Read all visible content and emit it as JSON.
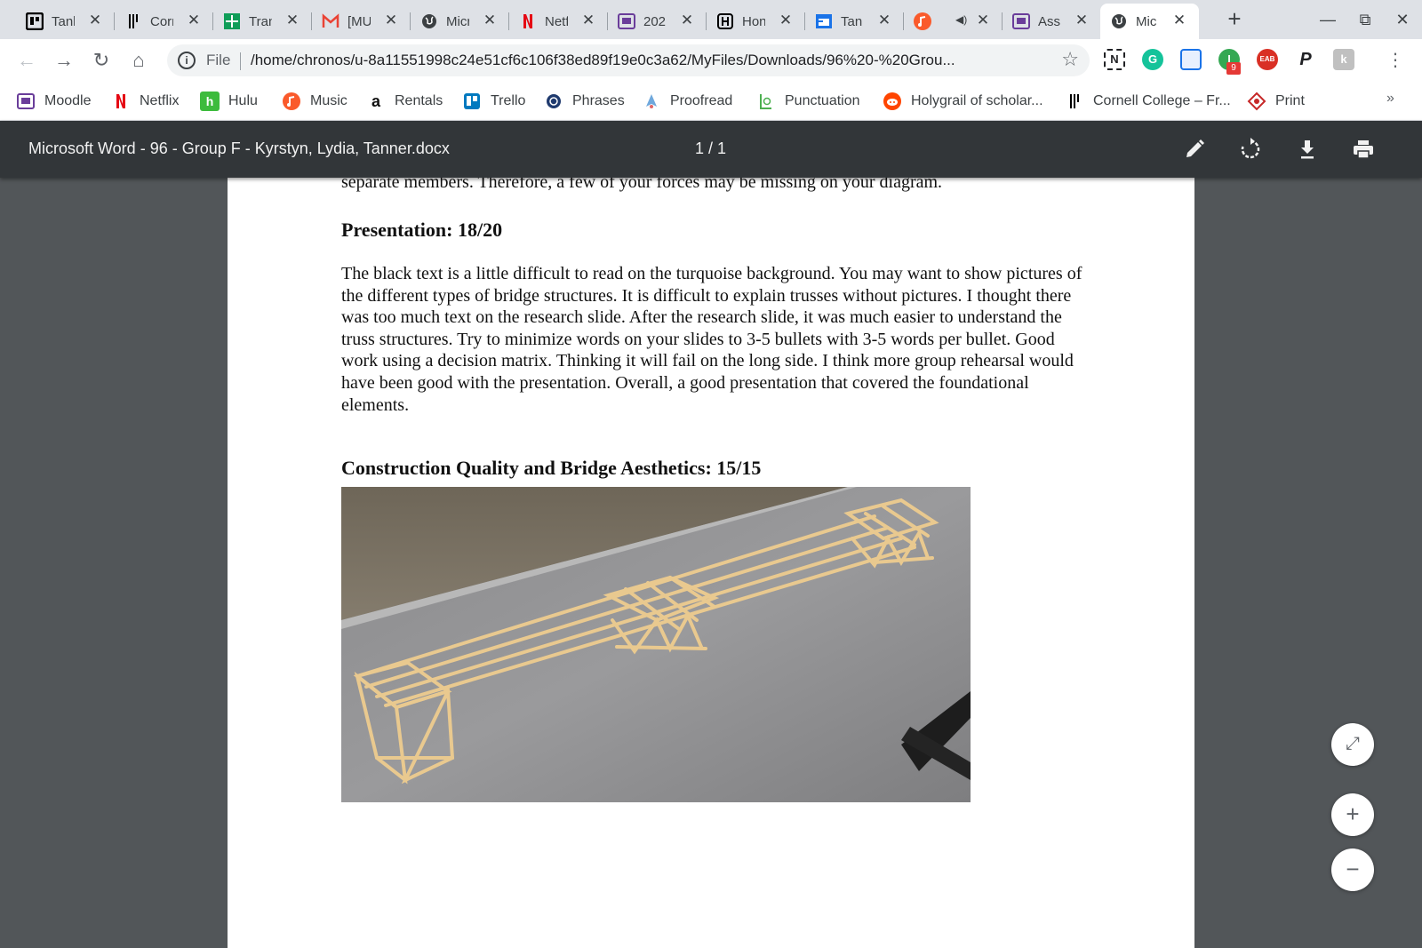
{
  "tabs": [
    {
      "label": "Tank",
      "icon": "trello-icon",
      "color": "#0079bf"
    },
    {
      "label": "Corn",
      "icon": "cornell-icon",
      "color": "#000000"
    },
    {
      "label": "Trans",
      "icon": "google-sheets-icon",
      "color": "#0f9d58"
    },
    {
      "label": "[MU",
      "icon": "gmail-icon",
      "color": "#ea4335"
    },
    {
      "label": "Micr",
      "icon": "globe-icon",
      "color": "#3c4043"
    },
    {
      "label": "Netf",
      "icon": "netflix-icon",
      "color": "#e50914"
    },
    {
      "label": "202",
      "icon": "moodle-icon",
      "color": "#6a3d9a"
    },
    {
      "label": "Hon",
      "icon": "honor-code-icon",
      "color": "#000000"
    },
    {
      "label": "Tan",
      "icon": "calendar-icon",
      "color": "#1a73e8"
    },
    {
      "label": "",
      "icon": "music-icon",
      "color": "#fa5a2b"
    },
    {
      "label": "Ass",
      "icon": "moodle-icon",
      "color": "#6a3d9a"
    },
    {
      "label": "Mic",
      "icon": "globe-icon",
      "color": "#3c4043"
    }
  ],
  "window": {
    "minimize": "—",
    "restore": "⧉",
    "close": "✕",
    "new_tab": "+"
  },
  "toolbar": {
    "scheme": "File",
    "url": "/home/chronos/u-8a11551998c24e51cf6c106f38ed89f19e0c3a62/MyFiles/Downloads/96%20-%20Grou...",
    "extension_badge": "9"
  },
  "bookmarks": [
    {
      "label": "Moodle",
      "icon": "moodle-icon"
    },
    {
      "label": "Netflix",
      "icon": "netflix-icon"
    },
    {
      "label": "Hulu",
      "icon": "hulu-icon"
    },
    {
      "label": "Music",
      "icon": "music-icon"
    },
    {
      "label": "Rentals",
      "icon": "amazon-icon"
    },
    {
      "label": "Trello",
      "icon": "trello-icon"
    },
    {
      "label": "Phrases",
      "icon": "phrases-icon"
    },
    {
      "label": "Proofread",
      "icon": "proofread-icon"
    },
    {
      "label": "Punctuation",
      "icon": "punctuation-icon"
    },
    {
      "label": "Holygrail of scholar...",
      "icon": "reddit-icon"
    },
    {
      "label": "Cornell College – Fr...",
      "icon": "cornell-icon"
    },
    {
      "label": "Print",
      "icon": "print-icon"
    }
  ],
  "bookmarks_more": "»",
  "pdf": {
    "title": "Microsoft Word - 96 - Group F - Kyrstyn, Lydia, Tanner.docx",
    "page_indicator": "1 / 1"
  },
  "document": {
    "continuation": "separate members. Therefore, a few of your forces may be missing on your diagram.",
    "heading_presentation": "Presentation: 18/20",
    "presentation_text": "The black text is a little difficult to read on the turquoise background. You may want to show pictures of the different types of bridge structures. It is difficult to explain trusses without pictures. I thought there was too much text on the research slide. After the research slide, it was much easier to understand the truss structures. Try to minimize words on your slides to 3-5 bullets with 3-5 words per bullet. Good work using a decision matrix. Thinking it will fail on the long side. I think more group rehearsal would have been good with the presentation. Overall, a good presentation that covered the foundational elements.",
    "heading_construction": "Construction Quality and Bridge Aesthetics: 15/15"
  },
  "zoom": {
    "fit": "⤢",
    "zoom_in": "+",
    "zoom_out": "−"
  }
}
